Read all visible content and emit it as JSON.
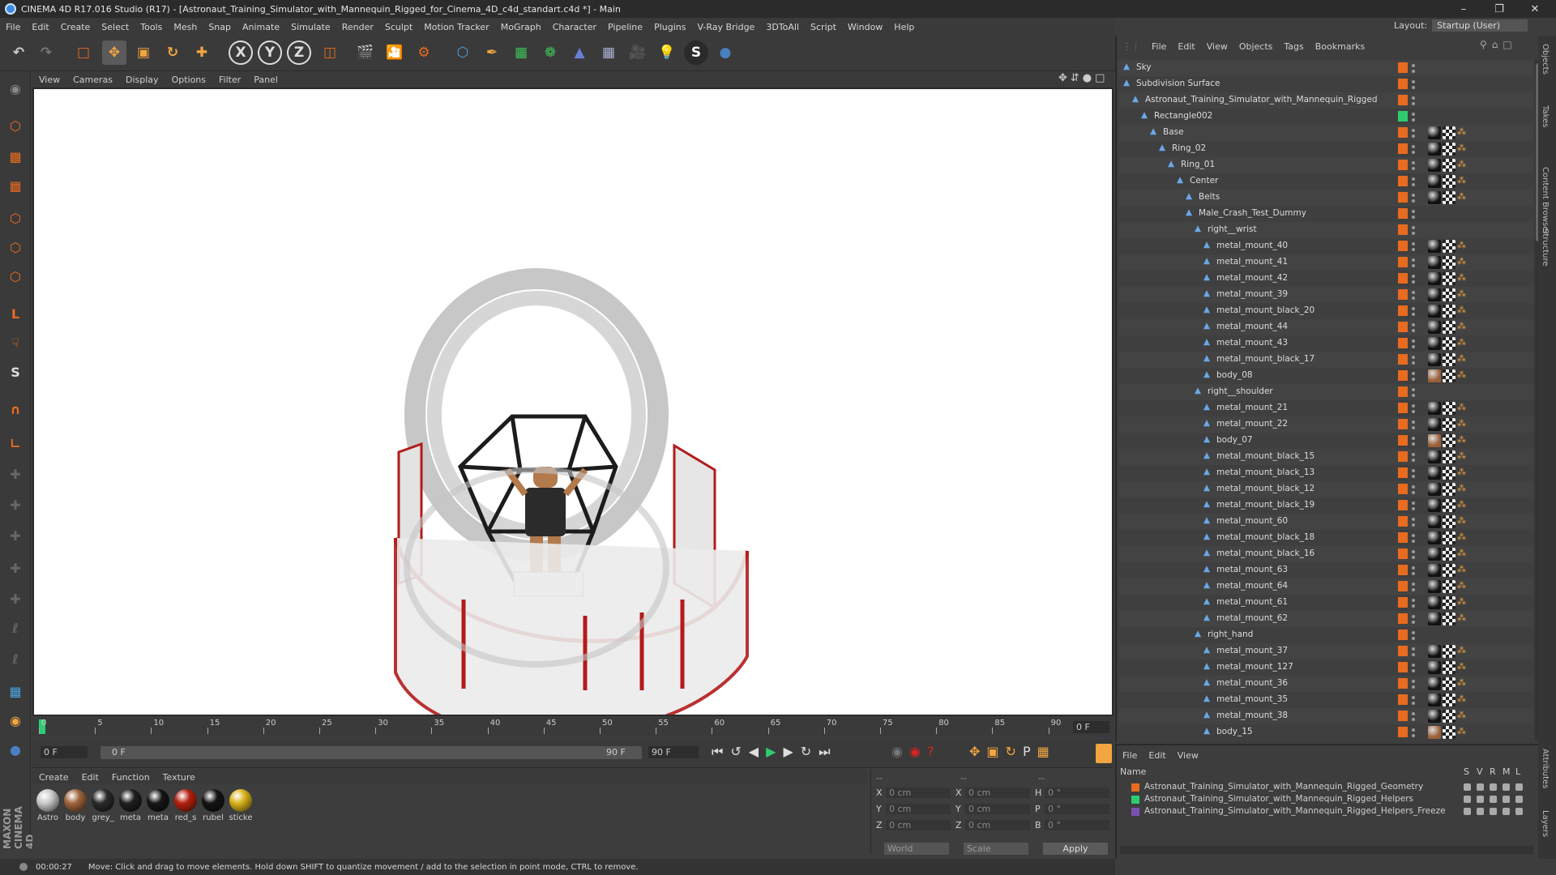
{
  "window": {
    "title": "CINEMA 4D R17.016 Studio (R17) - [Astronaut_Training_Simulator_with_Mannequin_Rigged_for_Cinema_4D_c4d_standart.c4d *] - Main",
    "layout_label": "Layout:",
    "layout_value": "Startup (User)"
  },
  "menubar": [
    "File",
    "Edit",
    "Create",
    "Select",
    "Tools",
    "Mesh",
    "Snap",
    "Animate",
    "Simulate",
    "Render",
    "Sculpt",
    "Motion Tracker",
    "MoGraph",
    "Character",
    "Pipeline",
    "Plugins",
    "V-Ray Bridge",
    "3DToAll",
    "Script",
    "Window",
    "Help"
  ],
  "viewport_menu": [
    "View",
    "Cameras",
    "Display",
    "Options",
    "Filter",
    "Panel"
  ],
  "timeline": {
    "ticks": [
      "0",
      "5",
      "10",
      "15",
      "20",
      "25",
      "30",
      "35",
      "40",
      "45",
      "50",
      "55",
      "60",
      "65",
      "70",
      "75",
      "80",
      "85",
      "90"
    ],
    "end_field": "0 F"
  },
  "transport": {
    "current_frame": "0 F",
    "range_start": "0 F",
    "range_end": "90 F",
    "max_frame": "90 F"
  },
  "material_menu": [
    "Create",
    "Edit",
    "Function",
    "Texture"
  ],
  "materials": [
    {
      "label": "Astro",
      "color": "#c9c9c9"
    },
    {
      "label": "body",
      "color": "#a0643c"
    },
    {
      "label": "grey_",
      "color": "#2a2a2a"
    },
    {
      "label": "meta",
      "color": "#1e1e1e"
    },
    {
      "label": "meta",
      "color": "#161616"
    },
    {
      "label": "red_s",
      "color": "#b4200f"
    },
    {
      "label": "rubel",
      "color": "#141414"
    },
    {
      "label": "sticke",
      "color": "#d9b21a"
    }
  ],
  "coords": {
    "header_left": "--",
    "header_mid": "--",
    "header_right": "--",
    "rows": [
      {
        "a": "X",
        "av": "0 cm",
        "b": "X",
        "bv": "0 cm",
        "c": "H",
        "cv": "0 °"
      },
      {
        "a": "Y",
        "av": "0 cm",
        "b": "Y",
        "bv": "0 cm",
        "c": "P",
        "cv": "0 °"
      },
      {
        "a": "Z",
        "av": "0 cm",
        "b": "Z",
        "bv": "0 cm",
        "c": "B",
        "cv": "0 °"
      }
    ],
    "mode": "World",
    "size_mode": "Scale",
    "apply": "Apply"
  },
  "status": {
    "time": "00:00:27",
    "message": "Move: Click and drag to move elements. Hold down SHIFT to quantize movement / add to the selection in point mode, CTRL to remove."
  },
  "objects_menu": [
    "File",
    "Edit",
    "View",
    "Objects",
    "Tags",
    "Bookmarks"
  ],
  "objects": [
    {
      "name": "Sky",
      "depth": 0,
      "tags": ""
    },
    {
      "name": "Subdivision Surface",
      "depth": 0,
      "tags": ""
    },
    {
      "name": "Astronaut_Training_Simulator_with_Mannequin_Rigged",
      "depth": 1,
      "tags": ""
    },
    {
      "name": "Rectangle002",
      "depth": 2,
      "tags": "green"
    },
    {
      "name": "Base",
      "depth": 3,
      "tags": "mat"
    },
    {
      "name": "Ring_02",
      "depth": 4,
      "tags": "mat"
    },
    {
      "name": "Ring_01",
      "depth": 5,
      "tags": "mat"
    },
    {
      "name": "Center",
      "depth": 6,
      "tags": "mat"
    },
    {
      "name": "Belts",
      "depth": 7,
      "tags": "mat"
    },
    {
      "name": "Male_Crash_Test_Dummy",
      "depth": 7,
      "tags": ""
    },
    {
      "name": "right__wrist",
      "depth": 8,
      "tags": ""
    },
    {
      "name": "metal_mount_40",
      "depth": 9,
      "tags": "mat"
    },
    {
      "name": "metal_mount_41",
      "depth": 9,
      "tags": "mat"
    },
    {
      "name": "metal_mount_42",
      "depth": 9,
      "tags": "mat"
    },
    {
      "name": "metal_mount_39",
      "depth": 9,
      "tags": "mat"
    },
    {
      "name": "metal_mount_black_20",
      "depth": 9,
      "tags": "mat"
    },
    {
      "name": "metal_mount_44",
      "depth": 9,
      "tags": "mat"
    },
    {
      "name": "metal_mount_43",
      "depth": 9,
      "tags": "mat"
    },
    {
      "name": "metal_mount_black_17",
      "depth": 9,
      "tags": "mat"
    },
    {
      "name": "body_08",
      "depth": 9,
      "tags": "body"
    },
    {
      "name": "right__shoulder",
      "depth": 8,
      "tags": ""
    },
    {
      "name": "metal_mount_21",
      "depth": 9,
      "tags": "mat"
    },
    {
      "name": "metal_mount_22",
      "depth": 9,
      "tags": "mat"
    },
    {
      "name": "body_07",
      "depth": 9,
      "tags": "body"
    },
    {
      "name": "metal_mount_black_15",
      "depth": 9,
      "tags": "mat"
    },
    {
      "name": "metal_mount_black_13",
      "depth": 9,
      "tags": "mat"
    },
    {
      "name": "metal_mount_black_12",
      "depth": 9,
      "tags": "mat"
    },
    {
      "name": "metal_mount_black_19",
      "depth": 9,
      "tags": "mat"
    },
    {
      "name": "metal_mount_60",
      "depth": 9,
      "tags": "mat"
    },
    {
      "name": "metal_mount_black_18",
      "depth": 9,
      "tags": "mat"
    },
    {
      "name": "metal_mount_black_16",
      "depth": 9,
      "tags": "mat"
    },
    {
      "name": "metal_mount_63",
      "depth": 9,
      "tags": "mat"
    },
    {
      "name": "metal_mount_64",
      "depth": 9,
      "tags": "mat"
    },
    {
      "name": "metal_mount_61",
      "depth": 9,
      "tags": "mat"
    },
    {
      "name": "metal_mount_62",
      "depth": 9,
      "tags": "mat"
    },
    {
      "name": "right_hand",
      "depth": 8,
      "tags": ""
    },
    {
      "name": "metal_mount_37",
      "depth": 9,
      "tags": "mat"
    },
    {
      "name": "metal_mount_127",
      "depth": 9,
      "tags": "mat"
    },
    {
      "name": "metal_mount_36",
      "depth": 9,
      "tags": "mat"
    },
    {
      "name": "metal_mount_35",
      "depth": 9,
      "tags": "mat"
    },
    {
      "name": "metal_mount_38",
      "depth": 9,
      "tags": "mat"
    },
    {
      "name": "body_15",
      "depth": 9,
      "tags": "body"
    }
  ],
  "layers_menu": [
    "File",
    "Edit",
    "View"
  ],
  "layers_header": {
    "name": "Name",
    "cols": [
      "S",
      "V",
      "R",
      "M",
      "L"
    ]
  },
  "layers": [
    {
      "name": "Astronaut_Training_Simulator_with_Mannequin_Rigged_Geometry",
      "color": "#e86b1f"
    },
    {
      "name": "Astronaut_Training_Simulator_with_Mannequin_Rigged_Helpers",
      "color": "#2ecc71"
    },
    {
      "name": "Astronaut_Training_Simulator_with_Mannequin_Rigged_Helpers_Freeze",
      "color": "#7b4fb5"
    }
  ],
  "side_tabs": [
    "Objects",
    "Takes",
    "Content Browser",
    "Structure"
  ],
  "side_tabs_bottom": [
    "Attributes",
    "Layers"
  ],
  "brand": "MAXON CINEMA 4D"
}
